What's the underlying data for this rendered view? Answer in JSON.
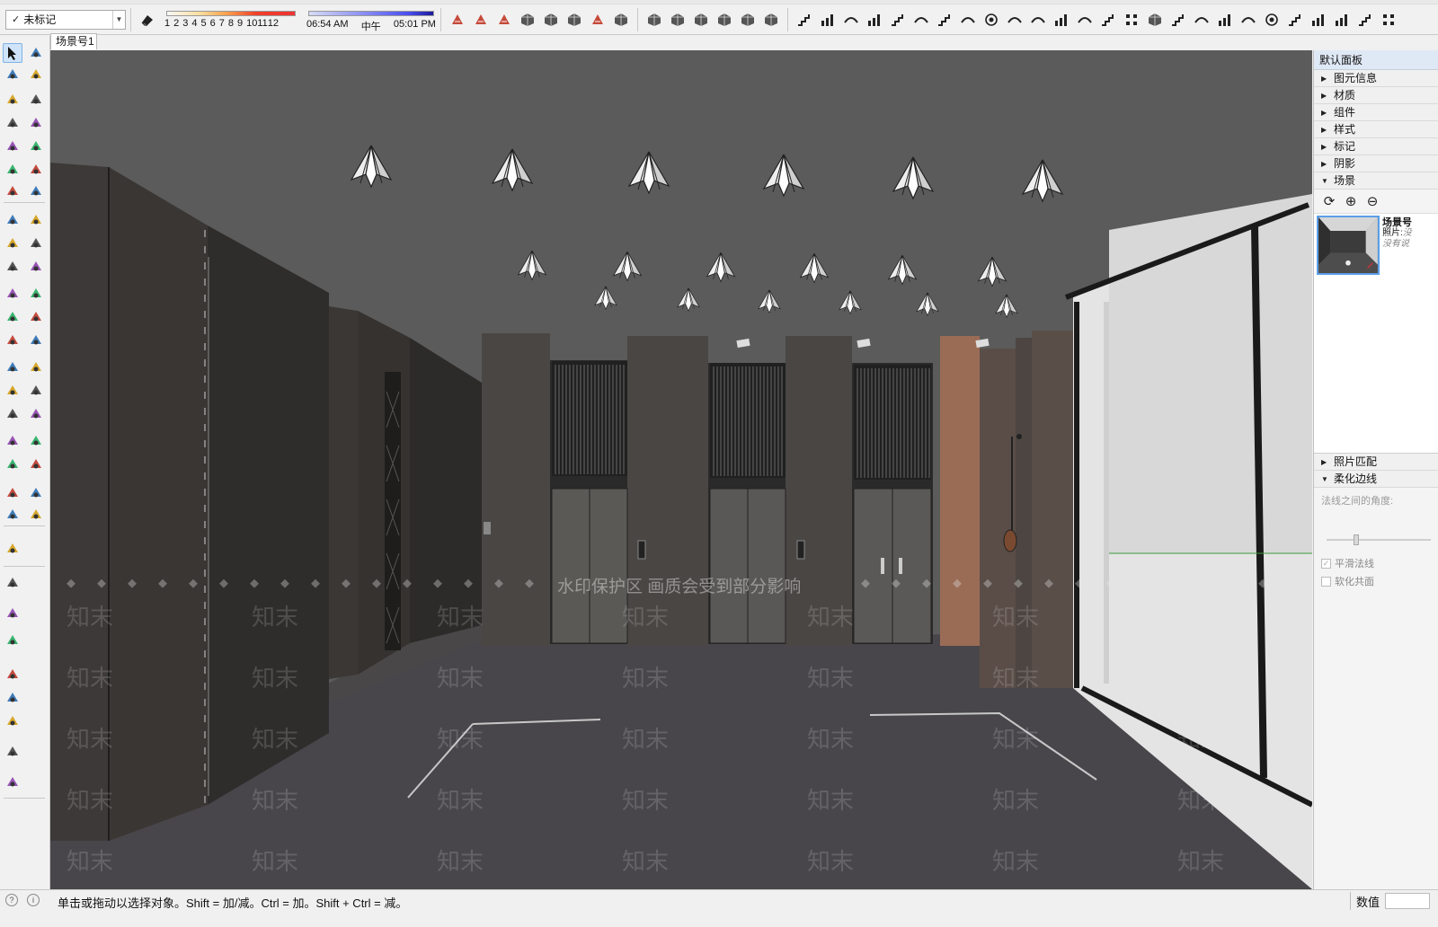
{
  "toolbar": {
    "tag_select_value": "未标记",
    "shadow_months": [
      "1",
      "2",
      "3",
      "4",
      "5",
      "6",
      "7",
      "8",
      "9",
      "10",
      "11",
      "12"
    ],
    "time_start": "06:54 AM",
    "time_noon": "中午",
    "time_end": "05:01 PM"
  },
  "scene_tab": {
    "label": "场景号1"
  },
  "viewport": {
    "watermark_banner": "水印保护区   画质会受到部分影响",
    "watermark_mark": "知末"
  },
  "tray": {
    "title": "默认面板",
    "panels": [
      {
        "label": "图元信息",
        "expanded": false
      },
      {
        "label": "材质",
        "expanded": false
      },
      {
        "label": "组件",
        "expanded": false
      },
      {
        "label": "样式",
        "expanded": false
      },
      {
        "label": "标记",
        "expanded": false
      },
      {
        "label": "阴影",
        "expanded": false
      },
      {
        "label": "场景",
        "expanded": true
      }
    ],
    "scene": {
      "name": "场景号",
      "photo_label": "照片:",
      "photo_value": "没",
      "desc": "没有说"
    },
    "photo_match_label": "照片匹配",
    "soften_label": "柔化边线",
    "soften_angle_label": "法线之间的角度:",
    "smooth_normals_label": "平滑法线",
    "soften_coplanar_label": "软化共面"
  },
  "statusbar": {
    "message": "单击或拖动以选择对象。Shift = 加/减。Ctrl = 加。Shift + Ctrl = 减。",
    "measure_label": "数值"
  },
  "colors": {
    "viewport_bg": "#5b5b5b",
    "wall_dark": "#3b3837",
    "floor": "#4a4749",
    "accent_wood": "#a0705a",
    "selection_blue": "#5a9ee8"
  }
}
